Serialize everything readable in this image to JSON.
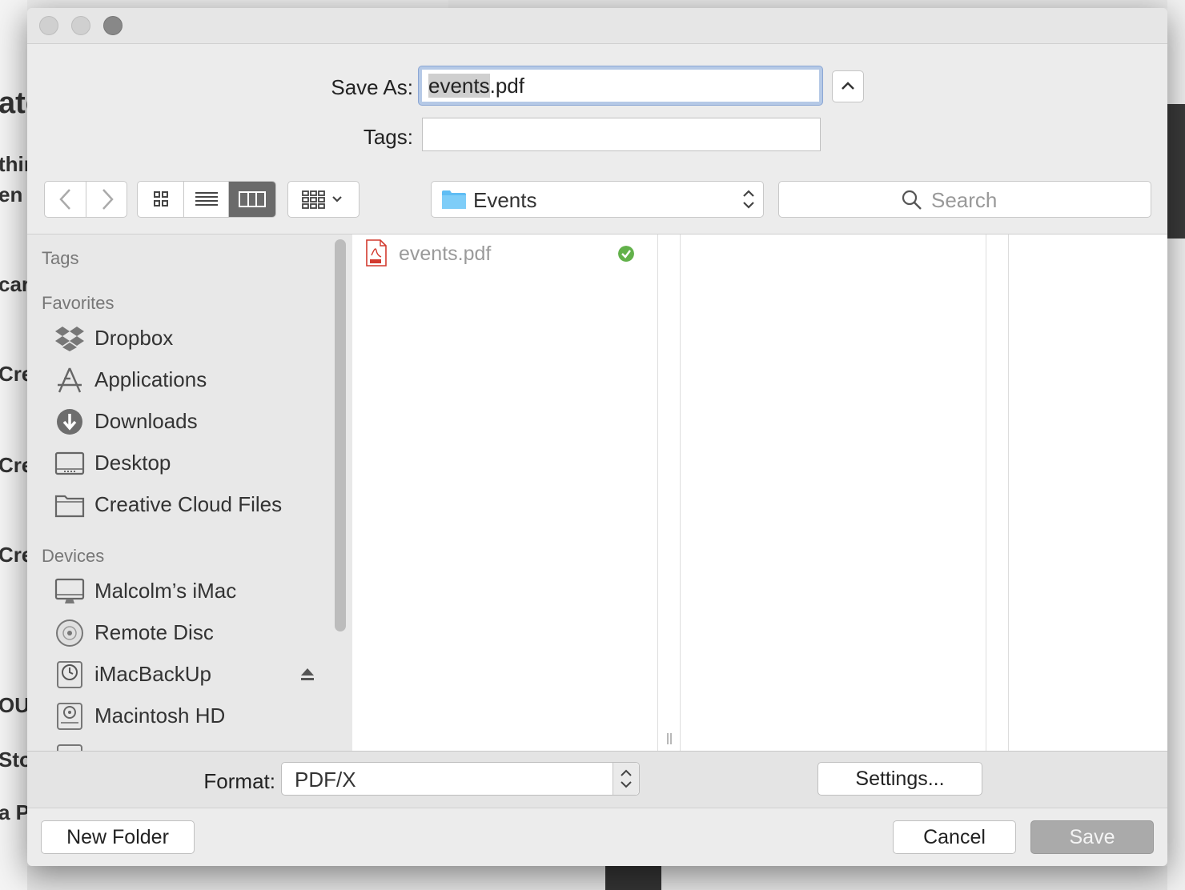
{
  "dialog": {
    "save_as_label": "Save As:",
    "filename_base": "events",
    "filename_ext": ".pdf",
    "tags_label": "Tags:",
    "tags_value": ""
  },
  "toolbar": {
    "location": "Events",
    "search_placeholder": "Search"
  },
  "sidebar": {
    "tags_header": "Tags",
    "favorites_header": "Favorites",
    "favorites": [
      {
        "label": "Dropbox",
        "icon": "dropbox-icon"
      },
      {
        "label": "Applications",
        "icon": "applications-icon"
      },
      {
        "label": "Downloads",
        "icon": "downloads-icon"
      },
      {
        "label": "Desktop",
        "icon": "desktop-icon"
      },
      {
        "label": "Creative Cloud Files",
        "icon": "folder-icon"
      }
    ],
    "devices_header": "Devices",
    "devices": [
      {
        "label": "Malcolm’s iMac",
        "icon": "imac-icon"
      },
      {
        "label": "Remote Disc",
        "icon": "disc-icon"
      },
      {
        "label": "iMacBackUp",
        "icon": "time-machine-disk-icon"
      },
      {
        "label": "Macintosh HD",
        "icon": "hard-drive-icon"
      }
    ]
  },
  "browser": {
    "files": [
      {
        "name": "events.pdf",
        "icon": "pdf-icon",
        "status": "synced"
      }
    ]
  },
  "format": {
    "label": "Format:",
    "value": "PDF/X",
    "settings_label": "Settings..."
  },
  "footer": {
    "new_folder": "New Folder",
    "cancel": "Cancel",
    "save": "Save"
  },
  "colors": {
    "accent": "#5fbdf4",
    "synced": "#62b14a",
    "pdf": "#d23a2f"
  }
}
